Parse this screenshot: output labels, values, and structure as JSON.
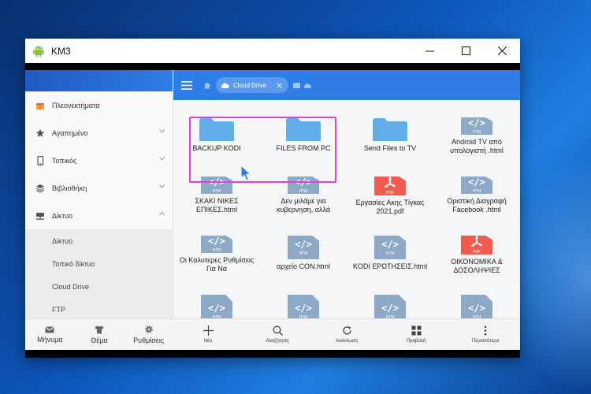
{
  "window": {
    "title": "KM3"
  },
  "sidebar": {
    "items": [
      {
        "label": "Πλεονεκτήματα",
        "icon": "gift-icon"
      },
      {
        "label": "Αγαπημένο",
        "icon": "star-icon"
      },
      {
        "label": "Τοπικός",
        "icon": "phone-icon"
      },
      {
        "label": "Βιβλιοθήκη",
        "icon": "layers-icon"
      },
      {
        "label": "Δίκτυο",
        "icon": "network-icon"
      }
    ],
    "sub_items": [
      "Δίκτυο",
      "Τοπικό δίκτυο",
      "Cloud Drive",
      "FTP"
    ],
    "bottom": [
      {
        "label": "Μήνυμα",
        "icon": "mail-icon"
      },
      {
        "label": "Θέμα",
        "icon": "shirt-icon"
      },
      {
        "label": "Ρυθμίσεις",
        "icon": "gear-icon"
      }
    ]
  },
  "toolbar": {
    "location_label": "Cloud Drive"
  },
  "files": [
    {
      "name": "BACKUP KODI",
      "type": "folder"
    },
    {
      "name": "FILES FROM PC",
      "type": "folder"
    },
    {
      "name": "Send Files to TV",
      "type": "folder"
    },
    {
      "name": "Android TV από υπολογιστή .html",
      "type": "htm"
    },
    {
      "name": "ΣΚΑΚΙ ΝΙΚΕΣ ΕΠΙΚΕΣ.html",
      "type": "htm"
    },
    {
      "name": "Δεν μιλάμε για κυβερνηση, αλλά",
      "type": "htm"
    },
    {
      "name": "Εργασίες Ακης Τίγκας 2021.pdf",
      "type": "pdf"
    },
    {
      "name": "Οριστική Διαγραφή Facebook .html",
      "type": "htm"
    },
    {
      "name": "Οι Καλυτερες Ρυθμίσεις Για Να",
      "type": "htm"
    },
    {
      "name": "αρχείο CON.html",
      "type": "htm"
    },
    {
      "name": "KODI ΕΡΩΤΗΣΕΙΣ.html",
      "type": "htm"
    },
    {
      "name": "ΟΙΚΟΝΟΜΙΚΑ & ΔΟΣΟΛΗΨΙΕΣ",
      "type": "pdf"
    },
    {
      "name": "",
      "type": "htm"
    },
    {
      "name": "",
      "type": "htm"
    },
    {
      "name": "",
      "type": "htm"
    },
    {
      "name": "",
      "type": "htm"
    }
  ],
  "file_tags": {
    "htm": "HTM",
    "pdf": "PDF",
    "code": "</>"
  },
  "bottombar": [
    {
      "label": "Νέο",
      "icon": "plus-icon"
    },
    {
      "label": "Αναζήτηση",
      "icon": "search-icon"
    },
    {
      "label": "Ανανέωση",
      "icon": "refresh-icon"
    },
    {
      "label": "Προβολή",
      "icon": "grid-view-icon"
    },
    {
      "label": "Περισσότερα",
      "icon": "more-vert-icon"
    }
  ],
  "colors": {
    "accent": "#2f7de6",
    "folder": "#62aee8",
    "htm": "#8ea9c8",
    "pdf": "#f05a4f",
    "selection": "#e33de3"
  }
}
